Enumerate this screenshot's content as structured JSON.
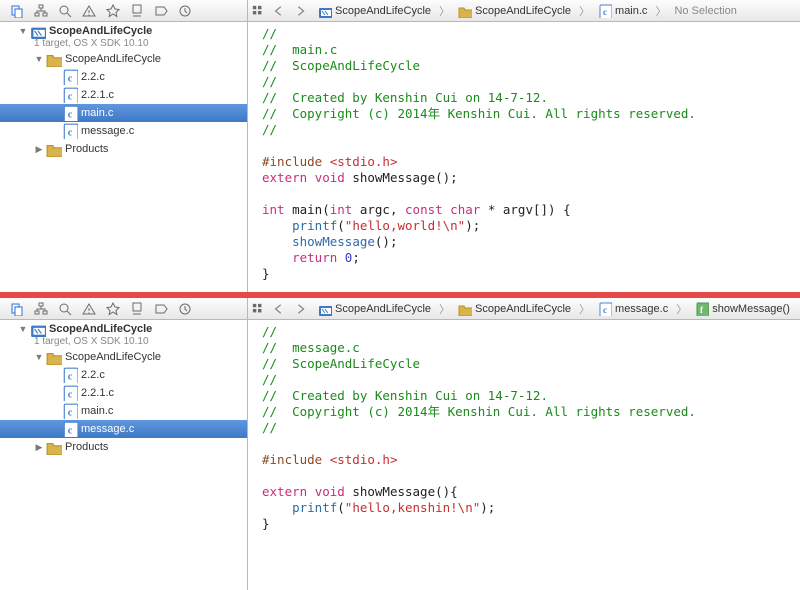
{
  "panes": [
    {
      "project": {
        "name": "ScopeAndLifeCycle",
        "subtitle": "1 target, OS X SDK 10.10"
      },
      "tree": {
        "group": "ScopeAndLifeCycle",
        "files": [
          "2.2.c",
          "2.2.1.c",
          "main.c",
          "message.c"
        ],
        "selected": "main.c",
        "products": "Products"
      },
      "breadcrumbs": [
        {
          "icon": "xcode",
          "label": "ScopeAndLifeCycle"
        },
        {
          "icon": "folder",
          "label": "ScopeAndLifeCycle"
        },
        {
          "icon": "c",
          "label": "main.c"
        }
      ],
      "trailing": "No Selection",
      "code_lines": [
        {
          "t": "cmt",
          "s": "//"
        },
        {
          "t": "cmt",
          "s": "//  main.c"
        },
        {
          "t": "cmt",
          "s": "//  ScopeAndLifeCycle"
        },
        {
          "t": "cmt",
          "s": "//"
        },
        {
          "t": "cmt",
          "s": "//  Created by Kenshin Cui on 14-7-12."
        },
        {
          "t": "cmt",
          "s": "//  Copyright (c) 2014年 Kenshin Cui. All rights reserved."
        },
        {
          "t": "cmt",
          "s": "//"
        },
        {
          "t": "blank",
          "s": ""
        },
        {
          "t": "include",
          "dir": "#include ",
          "hdr": "<stdio.h>"
        },
        {
          "t": "extern_decl",
          "kw1": "extern ",
          "kw2": "void ",
          "fn": "showMessage",
          "tail": "();"
        },
        {
          "t": "blank",
          "s": ""
        },
        {
          "t": "main_sig",
          "kw_int": "int ",
          "name": "main(",
          "kw_int2": "int ",
          "p1": "argc, ",
          "kw_const": "const ",
          "kw_char": "char ",
          "rest": "* argv[]) {"
        },
        {
          "t": "printf",
          "indent": "    ",
          "fn": "printf",
          "open": "(",
          "str": "\"hello,world!\\n\"",
          "close": ");"
        },
        {
          "t": "call",
          "indent": "    ",
          "fn": "showMessage",
          "tail": "();"
        },
        {
          "t": "return",
          "indent": "    ",
          "kw": "return ",
          "num": "0",
          "tail": ";"
        },
        {
          "t": "plain",
          "s": "}"
        }
      ]
    },
    {
      "project": {
        "name": "ScopeAndLifeCycle",
        "subtitle": "1 target, OS X SDK 10.10"
      },
      "tree": {
        "group": "ScopeAndLifeCycle",
        "files": [
          "2.2.c",
          "2.2.1.c",
          "main.c",
          "message.c"
        ],
        "selected": "message.c",
        "products": "Products"
      },
      "breadcrumbs": [
        {
          "icon": "xcode",
          "label": "ScopeAndLifeCycle"
        },
        {
          "icon": "folder",
          "label": "ScopeAndLifeCycle"
        },
        {
          "icon": "c",
          "label": "message.c"
        },
        {
          "icon": "fn",
          "label": "showMessage()"
        }
      ],
      "trailing": null,
      "code_lines": [
        {
          "t": "cmt",
          "s": "//"
        },
        {
          "t": "cmt",
          "s": "//  message.c"
        },
        {
          "t": "cmt",
          "s": "//  ScopeAndLifeCycle"
        },
        {
          "t": "cmt",
          "s": "//"
        },
        {
          "t": "cmt",
          "s": "//  Created by Kenshin Cui on 14-7-12."
        },
        {
          "t": "cmt",
          "s": "//  Copyright (c) 2014年 Kenshin Cui. All rights reserved."
        },
        {
          "t": "cmt",
          "s": "//"
        },
        {
          "t": "blank",
          "s": ""
        },
        {
          "t": "include",
          "dir": "#include ",
          "hdr": "<stdio.h>"
        },
        {
          "t": "blank",
          "s": ""
        },
        {
          "t": "extern_def",
          "kw1": "extern ",
          "kw2": "void ",
          "fn": "showMessage",
          "tail": "(){"
        },
        {
          "t": "printf",
          "indent": "    ",
          "fn": "printf",
          "open": "(",
          "str": "\"hello,kenshin!\\n\"",
          "close": ");"
        },
        {
          "t": "plain",
          "s": "}"
        }
      ]
    }
  ]
}
